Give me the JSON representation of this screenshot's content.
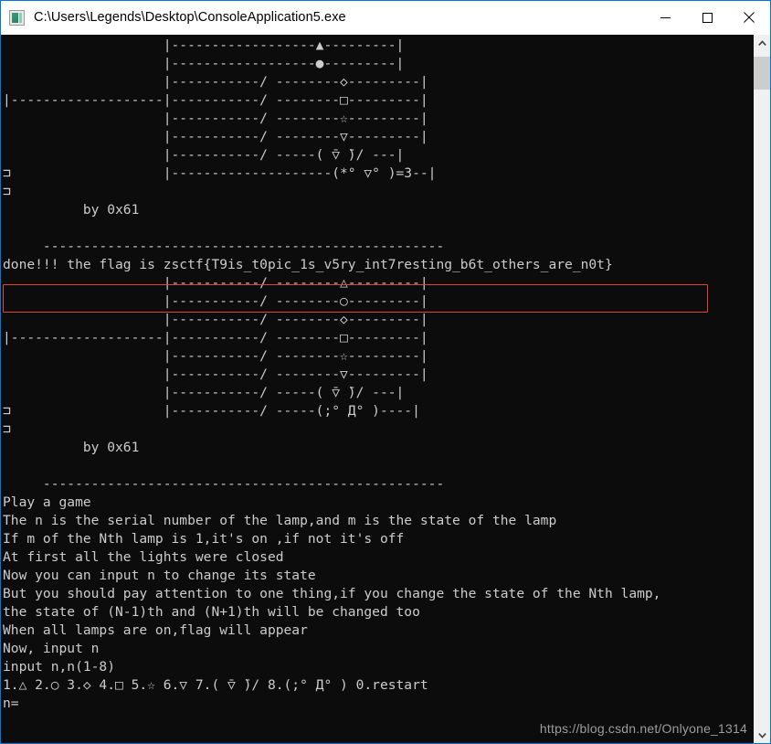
{
  "window": {
    "title": "C:\\Users\\Legends\\Desktop\\ConsoleApplication5.exe",
    "icon": "console-app-icon",
    "controls": {
      "minimize_label": "Minimize",
      "maximize_label": "Maximize",
      "close_label": "Close"
    }
  },
  "console": {
    "foreground_color": "#cccccc",
    "background_color": "#0c0c0c",
    "highlight_color": "#e8413c",
    "text": "                    |------------------▲---------|\n                    |------------------●---------|\n                    |-----------/ --------◇---------|\n|-------------------|-----------/ --------□---------|\n                    |-----------/ --------☆---------|\n                    |-----------/ --------▽---------|\n                    |-----------/ -----( ̄▽ ̄)/ ---|\n⊐                   |--------------------(*° ▽° )=3--|\n⊐\n          by 0x61\n\n     --------------------------------------------------\ndone!!! the flag is zsctf{T9is_t0pic_1s_v5ry_int7resting_b6t_others_are_n0t}\n                    |-----------/ --------△---------|\n                    |-----------/ --------○---------|\n                    |-----------/ --------◇---------|\n|-------------------|-----------/ --------□---------|\n                    |-----------/ --------☆---------|\n                    |-----------/ --------▽---------|\n                    |-----------/ -----( ̄▽ ̄)/ ---|\n⊐                   |-----------/ -----(;° Д° )----|\n⊐\n          by 0x61\n\n     --------------------------------------------------\nPlay a game\nThe n is the serial number of the lamp,and m is the state of the lamp\nIf m of the Nth lamp is 1,it's on ,if not it's off\nAt first all the lights were closed\nNow you can input n to change its state\nBut you should pay attention to one thing,if you change the state of the Nth lamp,\nthe state of (N-1)th and (N+1)th will be changed too\nWhen all lamps are on,flag will appear\nNow, input n\ninput n,n(1-8)\n1.△ 2.○ 3.◇ 4.□ 5.☆ 6.▽ 7.( ̄▽ ̄)/ 8.(;° Д° ) 0.restart\nn=",
    "flag_line": "done!!! the flag is zsctf{T9is_t0pic_1s_v5ry_int7resting_b6t_others_are_n0t}",
    "flag": "zsctf{T9is_t0pic_1s_v5ry_int7resting_b6t_others_are_n0t}",
    "author_credit": "by 0x61",
    "prompt": "n=",
    "menu_options": [
      "1.△",
      "2.○",
      "3.◇",
      "4.□",
      "5.☆",
      "6.▽",
      "7.( ̄▽ ̄)/",
      "8.(;° Д° )",
      "0.restart"
    ],
    "instructions": [
      "Play a game",
      "The n is the serial number of the lamp,and m is the state of the lamp",
      "If m of the Nth lamp is 1,it's on ,if not it's off",
      "At first all the lights were closed",
      "Now you can input n to change its state",
      "But you should pay attention to one thing,if you change the state of the Nth lamp,",
      "the state of (N-1)th and (N+1)th will be changed too",
      "When all lamps are on,flag will appear",
      "Now, input n",
      "input n,n(1-8)"
    ],
    "lamp_states_first_block": [
      "on",
      "on",
      "off",
      "off",
      "off",
      "off",
      "off",
      "off"
    ],
    "lamp_states_second_block": [
      "off",
      "off",
      "off",
      "off",
      "off",
      "off",
      "off",
      "off"
    ]
  },
  "watermark": {
    "text": "https://blog.csdn.net/Onlyone_1314"
  },
  "scrollbar": {
    "up_arrow": "chevron-up-icon",
    "down_arrow": "chevron-down-icon",
    "thumb_position_percent": 1
  }
}
